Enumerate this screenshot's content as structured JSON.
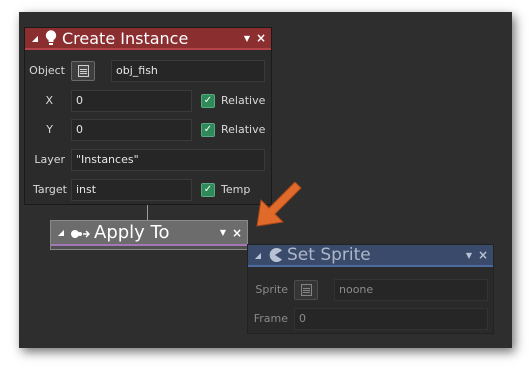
{
  "create_instance": {
    "title": "Create Instance",
    "collapse_icon": "triangle-icon",
    "header_icon": "lightbulb-icon",
    "menu_icon": "dropdown-icon",
    "close": "×",
    "object_label": "Object",
    "object_value": "obj_fish",
    "x_label": "X",
    "x_value": "0",
    "x_relative": "Relative",
    "y_label": "Y",
    "y_value": "0",
    "y_relative": "Relative",
    "layer_label": "Layer",
    "layer_value": "\"Instances\"",
    "target_label": "Target",
    "target_value": "inst",
    "target_temp": "Temp",
    "colors": {
      "header": "#8a2e30",
      "check": "#2f8a5a"
    }
  },
  "apply_to": {
    "title": "Apply To",
    "header_icon": "apply-to-icon",
    "close": "×"
  },
  "set_sprite": {
    "title": "Set Sprite",
    "header_icon": "pacman-icon",
    "close": "×",
    "sprite_label": "Sprite",
    "sprite_value": "noone",
    "frame_label": "Frame",
    "frame_value": "0",
    "colors": {
      "header": "#3a4a6a"
    }
  },
  "arrow": {
    "color": "#e06a2a"
  }
}
